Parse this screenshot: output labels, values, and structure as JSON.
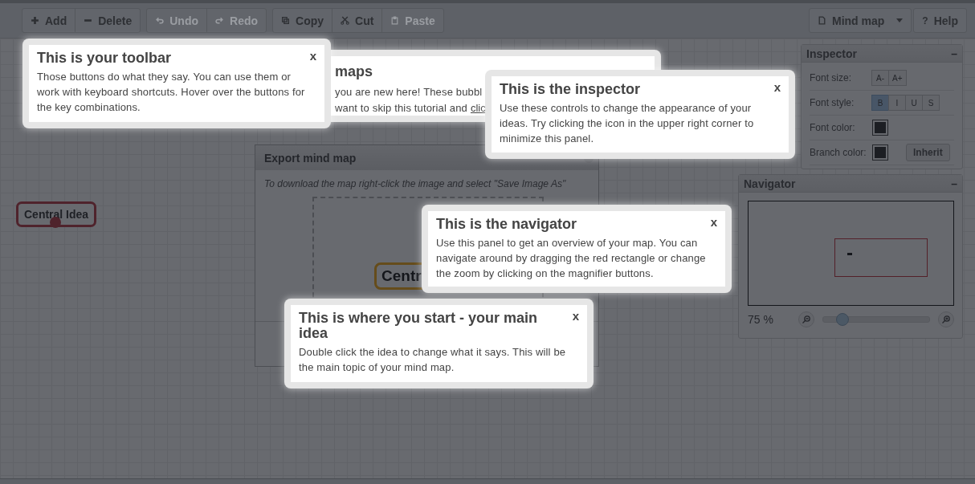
{
  "toolbar": {
    "groups": [
      [
        {
          "label": "Add",
          "disabled": false
        },
        {
          "label": "Delete",
          "disabled": false
        }
      ],
      [
        {
          "label": "Undo",
          "disabled": true
        },
        {
          "label": "Redo",
          "disabled": true
        }
      ],
      [
        {
          "label": "Copy",
          "disabled": false
        },
        {
          "label": "Cut",
          "disabled": false
        },
        {
          "label": "Paste",
          "disabled": true
        }
      ]
    ],
    "right": [
      {
        "label": "Mind map",
        "dropdown": true
      },
      {
        "label": "Help",
        "glyph": "?",
        "dropdown": false
      }
    ]
  },
  "node": {
    "text": "Central Idea"
  },
  "inspector": {
    "title": "Inspector",
    "minimize": "–",
    "rows": [
      {
        "kind": "buttons",
        "label": "Font size:",
        "buttons": [
          {
            "label": "A-",
            "selected": false
          },
          {
            "label": "A+",
            "selected": false
          }
        ]
      },
      {
        "kind": "buttons",
        "label": "Font style:",
        "buttons": [
          {
            "label": "B",
            "selected": true
          },
          {
            "label": "I",
            "selected": false
          },
          {
            "label": "U",
            "selected": false
          },
          {
            "label": "S",
            "selected": false
          }
        ]
      },
      {
        "kind": "color",
        "label": "Font color:",
        "color": "#1a1a1a"
      },
      {
        "kind": "color",
        "label": "Branch color:",
        "color": "#1a1a1a",
        "button": "Inherit"
      }
    ]
  },
  "navigator": {
    "title": "Navigator",
    "minimize": "–",
    "zoom": "75 %",
    "level": 0.18
  },
  "dialog": {
    "title": "Export mind map",
    "instruction": "To download the map right-click the image and select \"Save Image As\"",
    "preview_node": "Centr"
  },
  "hidden_bubble": {
    "title": "maps",
    "line_1": "you are new here! These bubbl",
    "line_2": "want to skip this tutorial and",
    "link": "clic"
  },
  "tips": [
    {
      "title": "This is your toolbar",
      "close": "x",
      "body": "Those buttons do what they say. You can use them or work with keyboard shortcuts. Hover over the buttons for the key combinations."
    },
    {
      "title": "This is the inspector",
      "close": "x",
      "body": "Use these controls to change the appearance of your ideas. Try clicking the icon in the upper right corner to minimize this panel."
    },
    {
      "title": "This is the navigator",
      "close": "x",
      "body": "Use this panel to get an overview of your map. You can navigate around by dragging the red rectangle or change the zoom by clicking on the magnifier buttons."
    },
    {
      "title": "This is where you start - your main idea",
      "close": "x",
      "body": "Double click the idea to change what it says. This will be the main topic of your mind map."
    }
  ]
}
